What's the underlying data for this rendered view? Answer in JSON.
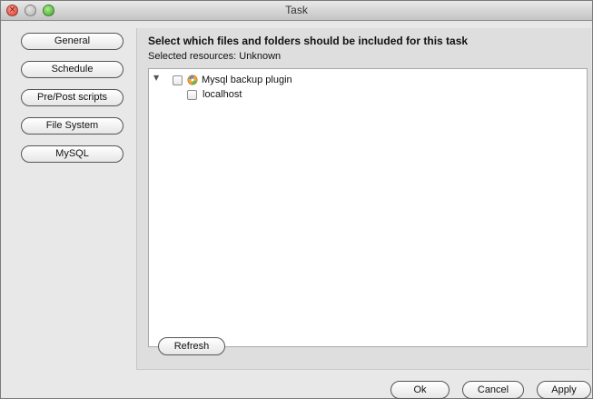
{
  "window": {
    "title": "Task"
  },
  "sidebar": {
    "items": [
      {
        "label": "General"
      },
      {
        "label": "Schedule"
      },
      {
        "label": "Pre/Post scripts"
      },
      {
        "label": "File System"
      },
      {
        "label": "MySQL"
      }
    ]
  },
  "main": {
    "heading": "Select which files and folders should be included for this task",
    "selected_resources": "Selected resources: Unknown",
    "tree": {
      "root": {
        "label": "Mysql backup plugin",
        "expanded": true,
        "checked": false,
        "icon": "plugin-icon"
      },
      "children": [
        {
          "label": "localhost",
          "checked": false
        }
      ]
    },
    "refresh_label": "Refresh"
  },
  "footer": {
    "ok_label": "Ok",
    "cancel_label": "Cancel",
    "apply_label": "Apply"
  },
  "colors": {
    "window_bg": "#e8e8e8",
    "close": "#d93a2f",
    "minimize": "#b0b0b0",
    "zoom": "#3ea326"
  }
}
